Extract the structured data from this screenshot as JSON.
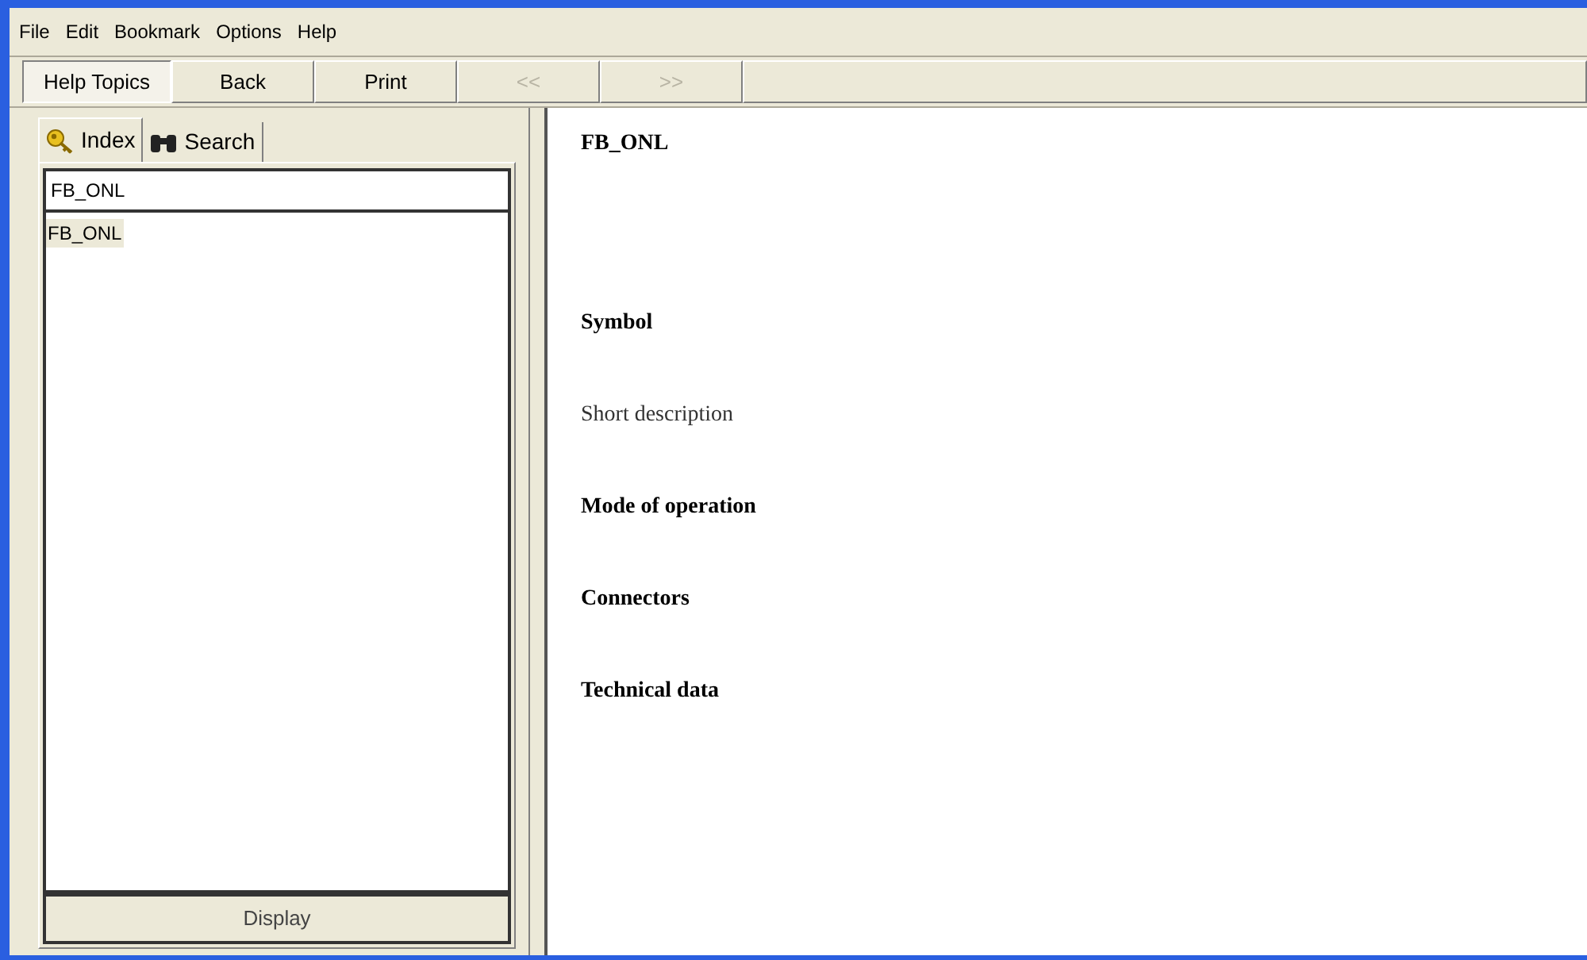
{
  "menu": [
    "File",
    "Edit",
    "Bookmark",
    "Options",
    "Help"
  ],
  "toolbar": [
    {
      "label": "Help Topics",
      "selected": true,
      "disabled": false
    },
    {
      "label": "Back",
      "selected": false,
      "disabled": false
    },
    {
      "label": "Print",
      "selected": false,
      "disabled": false
    },
    {
      "label": "<<",
      "selected": false,
      "disabled": true
    },
    {
      "label": ">>",
      "selected": false,
      "disabled": true
    }
  ],
  "tabs": [
    {
      "label": "Index",
      "kind": "key",
      "selected": true
    },
    {
      "label": "Search",
      "kind": "binoculars",
      "selected": false
    }
  ],
  "index_field": {
    "value": "FB_ONL"
  },
  "index_list": [
    {
      "label": "FB_ONL",
      "selected": true
    }
  ],
  "display_button": "Display",
  "content": [
    {
      "kind": "title",
      "text": "FB_ONL"
    },
    {
      "kind": "heading",
      "text": "Symbol"
    },
    {
      "kind": "text",
      "text": "Short description"
    },
    {
      "kind": "heading",
      "text": "Mode of operation"
    },
    {
      "kind": "heading",
      "text": "Connectors"
    },
    {
      "kind": "heading",
      "text": "Technical data"
    }
  ]
}
